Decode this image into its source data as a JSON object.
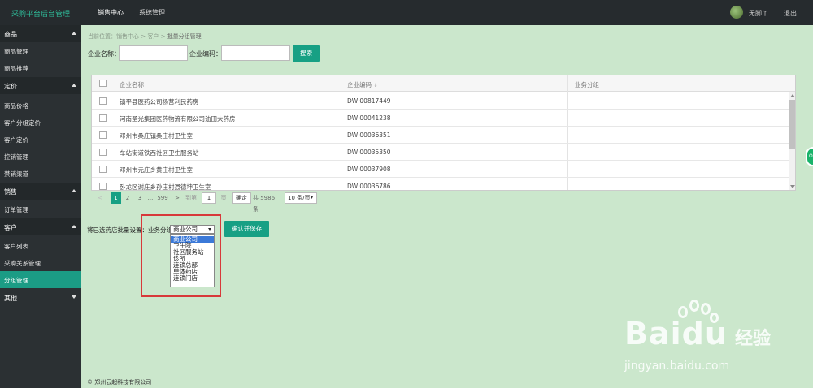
{
  "app": {
    "brand": "采购平台后台管理",
    "nav": [
      "销售中心",
      "系统管理"
    ],
    "active_nav": "销售中心",
    "user": "无脚丫",
    "logout": "退出"
  },
  "sidebar": {
    "groups": [
      {
        "label": "商品",
        "expanded": true,
        "items": [
          "商品管理",
          "商品推荐"
        ]
      },
      {
        "label": "定价",
        "expanded": true,
        "items": [
          "商品价格",
          "客户分组定价",
          "客户定价",
          "控销管理",
          "禁销渠道"
        ]
      },
      {
        "label": "销售",
        "expanded": true,
        "items": [
          "订单管理"
        ]
      },
      {
        "label": "客户",
        "expanded": true,
        "items": [
          "客户列表",
          "采购关系管理",
          "分组管理"
        ]
      },
      {
        "label": "其他",
        "expanded": false,
        "items": []
      }
    ],
    "active_item": "分组管理"
  },
  "breadcrumb": {
    "prefix": "当前位置：",
    "path": [
      "销售中心",
      "客户"
    ],
    "current": "批量分组管理",
    "sep": ">"
  },
  "search": {
    "company_name_label": "企业名称：",
    "company_name_value": "",
    "company_code_label": "企业编码：",
    "company_code_value": "",
    "search_button": "搜索"
  },
  "table": {
    "columns": [
      "企业名称",
      "企业编码",
      "业务分组"
    ],
    "sort_icon": "sort-icon",
    "rows": [
      {
        "name": "镇平县医药公司杨营利民药房",
        "code": "DWI00817449",
        "group": ""
      },
      {
        "name": "河南圣光集团医药物流有限公司油田大药房",
        "code": "DWI00041238",
        "group": ""
      },
      {
        "name": "邓州市桑庄镇桑庄村卫生室",
        "code": "DWI00036351",
        "group": ""
      },
      {
        "name": "车站街道铁西社区卫生服务站",
        "code": "DWI00035350",
        "group": ""
      },
      {
        "name": "邓州市元庄乡黄庄村卫生室",
        "code": "DWI00037908",
        "group": ""
      },
      {
        "name": "卧龙区谢庄乡孙庄村聂德坤卫生室",
        "code": "DWI00036786",
        "group": ""
      }
    ]
  },
  "pagination": {
    "prev": "<",
    "pages": [
      "1",
      "2",
      "3"
    ],
    "ellipsis": "...",
    "last_page": "599",
    "next": ">",
    "goto_label": "到第",
    "goto_value": "1",
    "page_unit": "页",
    "confirm": "确定",
    "total": "共 5986 条",
    "page_size": "10 条/页",
    "current_page": 1
  },
  "bulk": {
    "label": "将已选药店批量设置：业务分组",
    "selected": "商业公司",
    "options": [
      "商业公司",
      "卫生院",
      "社区服务站",
      "诊所",
      "连锁总部",
      "单体药店",
      "连锁门店"
    ],
    "save_button": "确认并保存"
  },
  "footer": "© 郑州云起科技有限公司",
  "widget": "On",
  "watermark": {
    "brand": "Baidu",
    "cn": "经验",
    "url": "jingyan.baidu.com"
  },
  "colors": {
    "accent": "#17a084",
    "background": "#cbe7cc",
    "sidebar": "#2b3033",
    "topbar": "#262b2e",
    "highlight": "#d8393a",
    "option_selected": "#3b79d8"
  }
}
